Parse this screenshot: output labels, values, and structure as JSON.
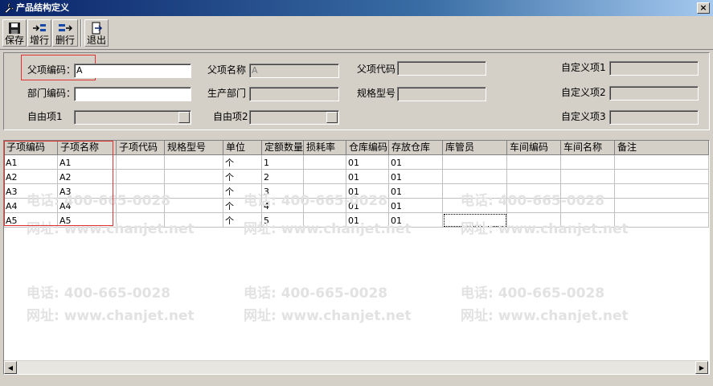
{
  "window": {
    "title": "产品结构定义",
    "close_label": "×"
  },
  "toolbar": {
    "save_label": "保存",
    "add_row_label": "增行",
    "delete_row_label": "删行",
    "exit_label": "退出"
  },
  "form": {
    "parent_code_label": "父项编码：",
    "parent_code_value": "A",
    "parent_name_label": "父项名称",
    "parent_name_value": "A",
    "parent_code2_label": "父项代码",
    "custom1_label": "自定义项1",
    "dept_code_label": "部门编码：",
    "prod_dept_label": "生产部门",
    "spec_label": "规格型号",
    "custom2_label": "自定义项2",
    "free1_label": "自由项1",
    "free2_label": "自由项2",
    "custom3_label": "自定义项3"
  },
  "table": {
    "columns": [
      "子项编码",
      "子项名称",
      "子项代码",
      "规格型号",
      "单位",
      "定额数量",
      "损耗率",
      "仓库编码",
      "存放仓库",
      "库管员",
      "车间编码",
      "车间名称",
      "备注"
    ],
    "rows": [
      {
        "code": "A1",
        "name": "A1",
        "unit": "个",
        "qty": "1",
        "wh_code": "01",
        "storage": "01"
      },
      {
        "code": "A2",
        "name": "A2",
        "unit": "个",
        "qty": "2",
        "wh_code": "01",
        "storage": "01"
      },
      {
        "code": "A3",
        "name": "A3",
        "unit": "个",
        "qty": "3",
        "wh_code": "01",
        "storage": "01"
      },
      {
        "code": "A4",
        "name": "A4",
        "unit": "个",
        "qty": "4",
        "wh_code": "01",
        "storage": "01"
      },
      {
        "code": "A5",
        "name": "A5",
        "unit": "个",
        "qty": "5",
        "wh_code": "01",
        "storage": "01"
      }
    ]
  },
  "watermark": {
    "phone": "电话: 400-665-0028",
    "site": "网址: www.chanjet.net"
  },
  "scroll": {
    "left_arrow": "◀",
    "right_arrow": "▶"
  },
  "colors": {
    "titlebar": "#0a246a",
    "highlight_box": "#e03030",
    "window_bg": "#d4d0c8"
  }
}
